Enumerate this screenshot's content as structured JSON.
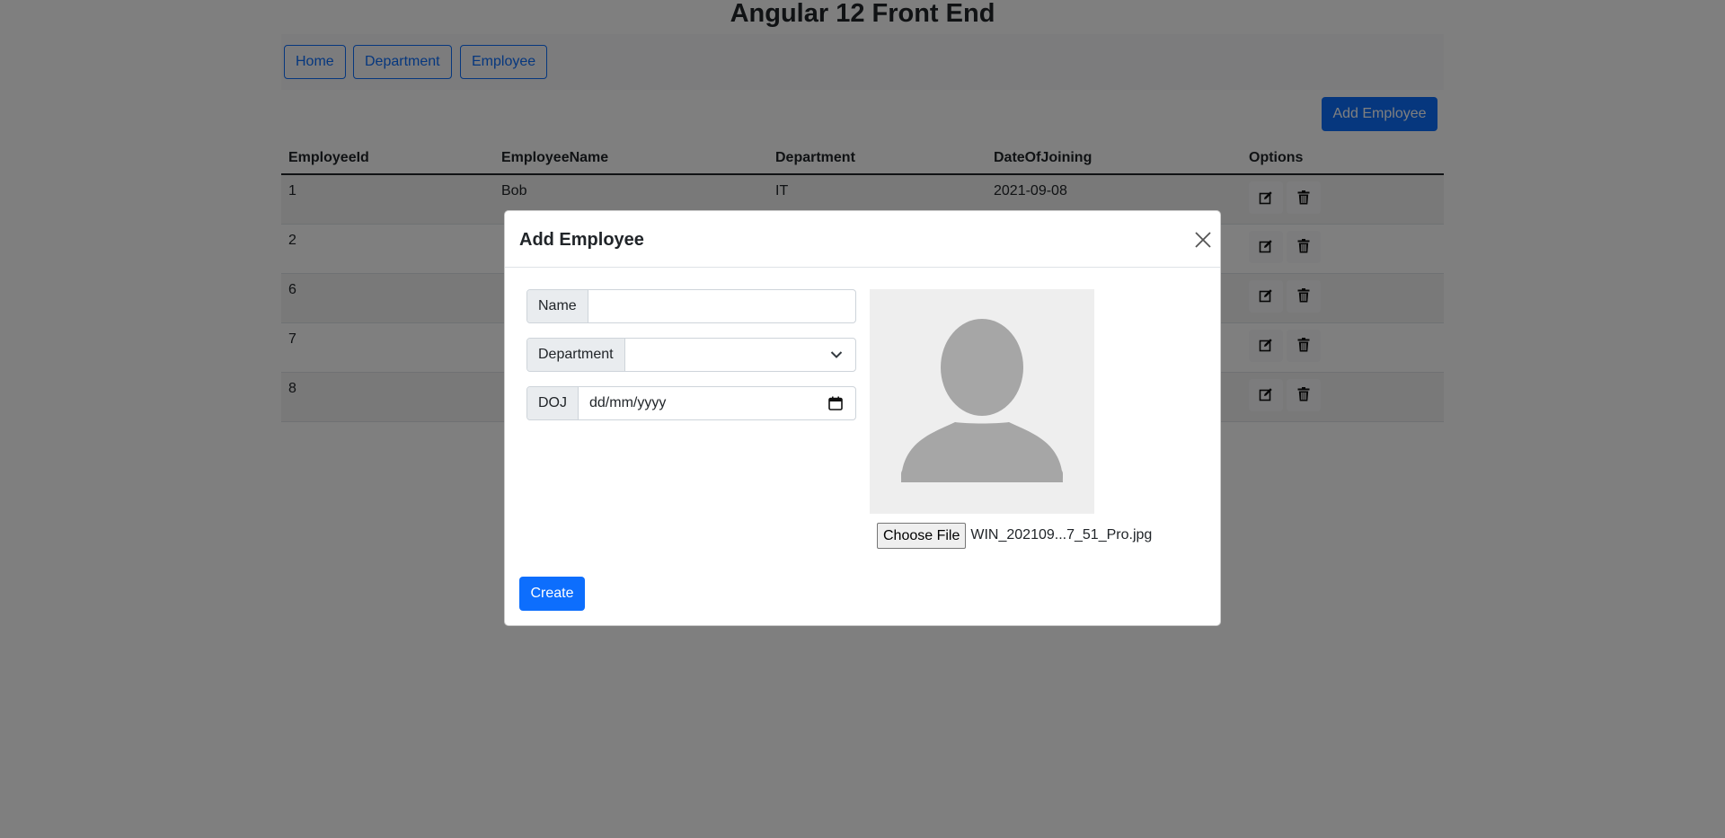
{
  "app": {
    "title": "Angular 12 Front End"
  },
  "nav": {
    "items": [
      {
        "label": "Home"
      },
      {
        "label": "Department"
      },
      {
        "label": "Employee"
      }
    ]
  },
  "toolbar": {
    "add_label": "Add Employee"
  },
  "table": {
    "headers": [
      "EmployeeId",
      "EmployeeName",
      "Department",
      "DateOfJoining",
      "Options"
    ],
    "rows": [
      {
        "id": "1",
        "name": "Bob",
        "department": "IT",
        "doj": "2021-09-08"
      },
      {
        "id": "2",
        "name": "",
        "department": "",
        "doj": ""
      },
      {
        "id": "6",
        "name": "",
        "department": "",
        "doj": ""
      },
      {
        "id": "7",
        "name": "",
        "department": "",
        "doj": ""
      },
      {
        "id": "8",
        "name": "",
        "department": "",
        "doj": ""
      }
    ],
    "row_icons": [
      "edit-icon",
      "trash-icon"
    ]
  },
  "modal": {
    "title": "Add Employee",
    "fields": {
      "name_label": "Name",
      "name_value": "",
      "department_label": "Department",
      "department_value": "",
      "doj_label": "DOJ",
      "doj_value": "dd/mm/yyyy"
    },
    "file": {
      "button_label": "Choose File",
      "file_name": "WIN_202109...7_51_Pro.jpg"
    },
    "create_label": "Create"
  },
  "colors": {
    "primary": "#0d6efd",
    "backdrop": "rgba(0,0,0,0.5)",
    "photo_bg": "#eeeeee",
    "silhouette": "#a6a6a6"
  }
}
